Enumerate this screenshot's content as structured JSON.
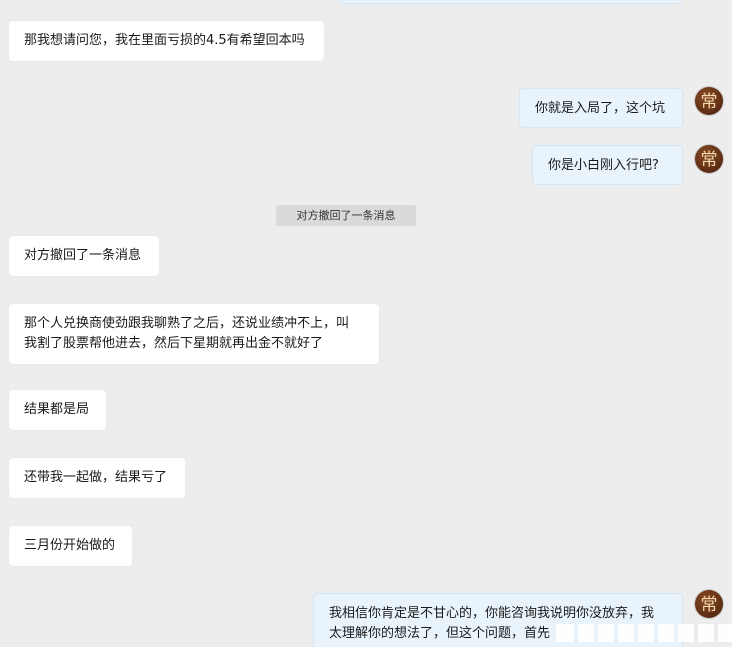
{
  "messages": [
    {
      "id": "m1",
      "side": "in",
      "text": "那我想请问您，我在里面亏损的4.5有希望回本吗"
    },
    {
      "id": "m2",
      "side": "out",
      "text": "你就是入局了，这个坑"
    },
    {
      "id": "m3",
      "side": "out",
      "text": "你是小白刚入行吧?"
    },
    {
      "id": "m4",
      "side": "in",
      "text": "对方撤回了一条消息"
    },
    {
      "id": "m5",
      "side": "in",
      "text": "那个人兑换商使劲跟我聊熟了之后，还说业绩冲不上，叫\n我割了股票帮他进去，然后下星期就再出金不就好了"
    },
    {
      "id": "m6",
      "side": "in",
      "text": "结果都是局"
    },
    {
      "id": "m7",
      "side": "in",
      "text": "还带我一起做，结果亏了"
    },
    {
      "id": "m8",
      "side": "in",
      "text": "三月份开始做的"
    },
    {
      "id": "m9",
      "side": "out",
      "text": "我相信你肯定是不甘心的，你能咨询我说明你没放弃，我\n太理解你的想法了，但这个问题，首先"
    }
  ],
  "system_notice": "对方撤回了一条消息",
  "avatar": {
    "icon": "calligraphy-avatar-icon",
    "glyph": "常"
  },
  "colors": {
    "background": "#ededed",
    "incoming_bubble": "#ffffff",
    "outgoing_bubble": "#e9f3fb",
    "notice_bg": "#dadada"
  }
}
